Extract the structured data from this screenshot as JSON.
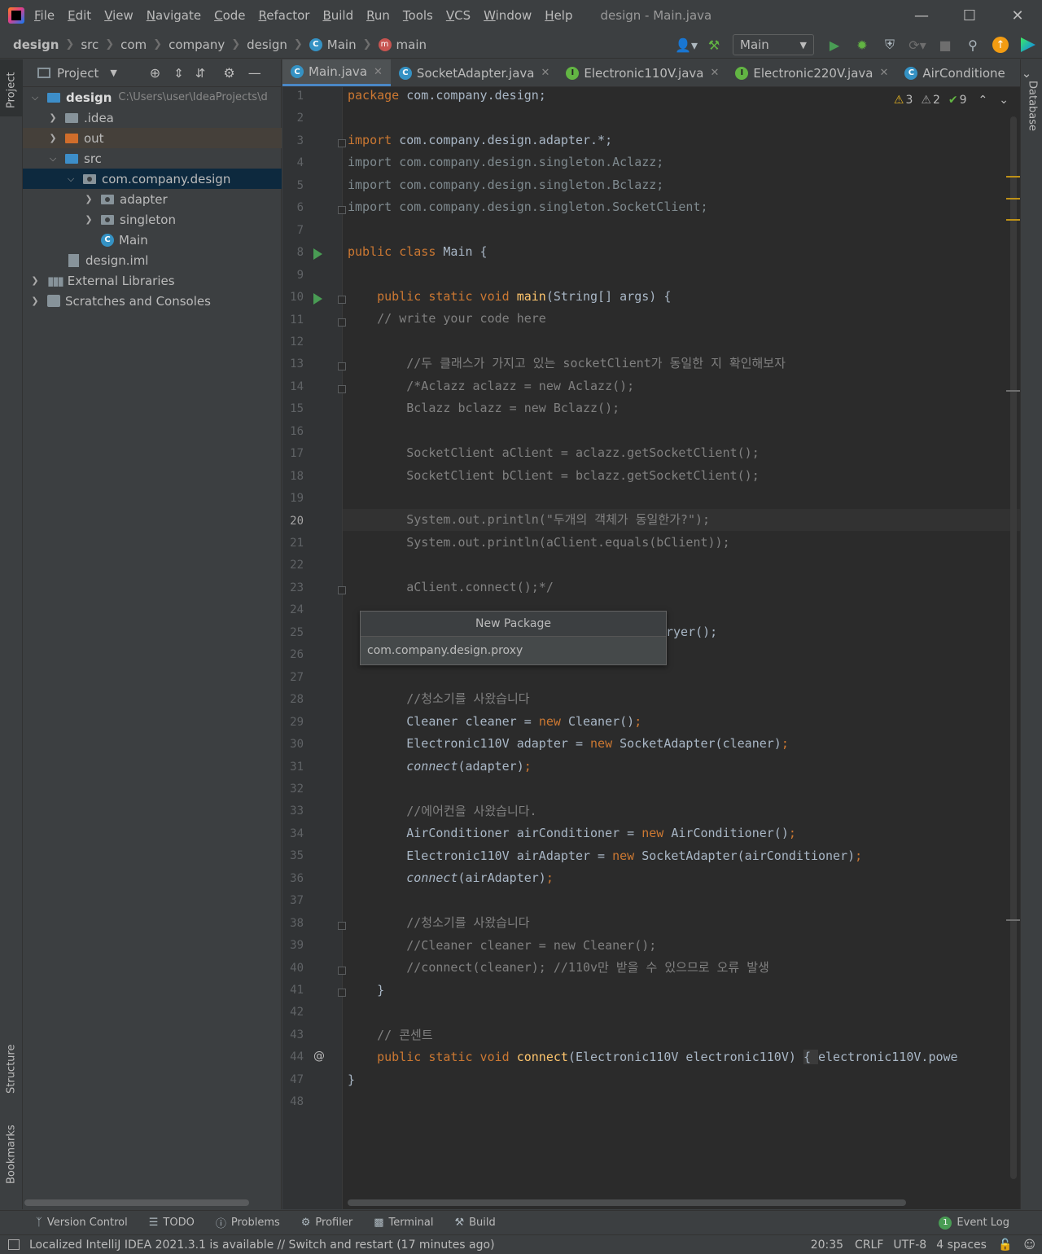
{
  "window": {
    "title": "design - Main.java",
    "menu": [
      "File",
      "Edit",
      "View",
      "Navigate",
      "Code",
      "Refactor",
      "Build",
      "Run",
      "Tools",
      "VCS",
      "Window",
      "Help"
    ]
  },
  "breadcrumbs": [
    "design",
    "src",
    "com",
    "company",
    "design",
    "Main",
    "main"
  ],
  "toolbar": {
    "run_config": "Main"
  },
  "left_strip": {
    "project": "Project",
    "structure": "Structure",
    "bookmarks": "Bookmarks"
  },
  "right_strip": {
    "database": "Database"
  },
  "project_panel": {
    "title": "Project",
    "tree": [
      {
        "label": "design",
        "extra": "C:\\Users\\user\\IdeaProjects\\d",
        "depth": 0,
        "expanded": true,
        "icon": "module-folder"
      },
      {
        "label": ".idea",
        "depth": 1,
        "expanded": false,
        "icon": "folder"
      },
      {
        "label": "out",
        "depth": 1,
        "expanded": false,
        "icon": "excluded-folder"
      },
      {
        "label": "src",
        "depth": 1,
        "expanded": true,
        "icon": "source-folder"
      },
      {
        "label": "com.company.design",
        "depth": 2,
        "expanded": true,
        "icon": "package",
        "selected": true
      },
      {
        "label": "adapter",
        "depth": 3,
        "expanded": false,
        "icon": "package"
      },
      {
        "label": "singleton",
        "depth": 3,
        "expanded": false,
        "icon": "package"
      },
      {
        "label": "Main",
        "depth": 3,
        "icon": "class"
      },
      {
        "label": "design.iml",
        "depth": 2,
        "icon": "iml-file"
      },
      {
        "label": "External Libraries",
        "depth": 0,
        "expanded": false,
        "icon": "libraries"
      },
      {
        "label": "Scratches and Consoles",
        "depth": 0,
        "expanded": false,
        "icon": "scratches"
      }
    ]
  },
  "tabs": [
    {
      "label": "Main.java",
      "icon": "class",
      "active": true
    },
    {
      "label": "SocketAdapter.java",
      "icon": "class"
    },
    {
      "label": "Electronic110V.java",
      "icon": "interface"
    },
    {
      "label": "Electronic220V.java",
      "icon": "interface"
    },
    {
      "label": "AirConditione",
      "icon": "class"
    }
  ],
  "inspections": {
    "warnings": "3",
    "weak_warnings": "2",
    "typos": "9"
  },
  "editor": {
    "current_line": 20,
    "lines": [
      "1",
      "2",
      "3",
      "4",
      "5",
      "6",
      "7",
      "8",
      "9",
      "10",
      "11",
      "12",
      "13",
      "14",
      "15",
      "16",
      "17",
      "18",
      "19",
      "20",
      "21",
      "22",
      "23",
      "24",
      "25",
      "26",
      "27",
      "28",
      "29",
      "30",
      "31",
      "32",
      "33",
      "34",
      "35",
      "36",
      "37",
      "38",
      "39",
      "40",
      "41",
      "42",
      "43",
      "44",
      "47",
      "48"
    ],
    "code": {
      "l1": "com.company.design;",
      "l3": "com.company.design.adapter.*;",
      "l4": "import com.company.design.singleton.Aclazz;",
      "l5": "import com.company.design.singleton.Bclazz;",
      "l6": "import com.company.design.singleton.SocketClient;",
      "l8": "Main {",
      "l10a": "main",
      "l10b": "(String[] args) {",
      "l11": "// write your code here",
      "l13": "//두 클래스가 가지고 있는 socketClient가 동일한 지 확인해보자",
      "l14": "/*Aclazz aclazz = new Aclazz();",
      "l15": "Bclazz bclazz = new Bclazz();",
      "l17": "SocketClient aClient = aclazz.getSocketClient();",
      "l18": "SocketClient bClient = bclazz.getSocketClient();",
      "l20": "System.out.println(\"두개의 객체가 동일한가?\");",
      "l21": "System.out.println(aClient.equals(bClient));",
      "l23": "aClient.connect();*/",
      "l25": "ryer();",
      "l28": "//청소기를 사왔습니다",
      "l29a": "Cleaner cleaner = ",
      "l29b": "Cleaner()",
      "l30a": "Electronic110V adapter = ",
      "l30b": "SocketAdapter(cleaner)",
      "l31a": "connect",
      "l31b": "(adapter)",
      "l33": "//에어컨을 사왔습니다.",
      "l34a": "AirConditioner airConditioner = ",
      "l34b": "AirConditioner()",
      "l35a": "Electronic110V airAdapter = ",
      "l35b": "SocketAdapter(airConditioner)",
      "l36a": "connect",
      "l36b": "(airAdapter)",
      "l38": "//청소기를 사왔습니다",
      "l39": "//Cleaner cleaner = new Cleaner();",
      "l40": "//connect(cleaner); //110v만 받을 수 있으므로 오류 발생",
      "l41": "}",
      "l43": "// 콘센트",
      "l44a": "connect",
      "l44b": "(Electronic110V electronic110V)",
      "l44c": "{ ",
      "l44d": "electronic110V.powe",
      "l47": "}"
    }
  },
  "popup": {
    "title": "New Package",
    "value": "com.company.design.proxy"
  },
  "tool_windows": [
    "Version Control",
    "TODO",
    "Problems",
    "Profiler",
    "Terminal",
    "Build"
  ],
  "event_log": {
    "count": "1",
    "label": "Event Log"
  },
  "status": {
    "message": "Localized IntelliJ IDEA 2021.3.1 is available // Switch and restart (17 minutes ago)",
    "position": "20:35",
    "line_sep": "CRLF",
    "encoding": "UTF-8",
    "indent": "4 spaces"
  }
}
